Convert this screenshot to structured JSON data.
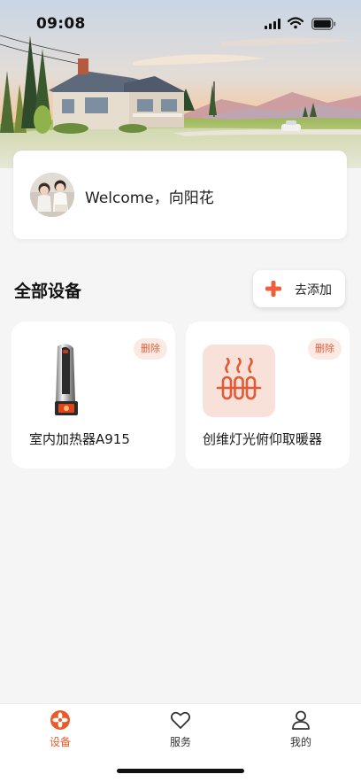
{
  "status_bar": {
    "time": "09:08",
    "icons": [
      "cellular-signal-icon",
      "wifi-icon",
      "battery-icon"
    ]
  },
  "welcome": {
    "text": "Welcome，向阳花",
    "avatar": "avatar"
  },
  "devices_section": {
    "title": "全部设备",
    "add_label": "去添加",
    "add_icon": "plus-icon"
  },
  "devices": [
    {
      "name": "室内加热器A915",
      "delete_label": "删除",
      "icon": "tower-heater-icon"
    },
    {
      "name": "创维灯光俯仰取暖器",
      "delete_label": "删除",
      "icon": "heater-waves-icon"
    }
  ],
  "tabbar": {
    "items": [
      {
        "label": "设备",
        "icon": "fan-icon",
        "active": true
      },
      {
        "label": "服务",
        "icon": "heart-icon",
        "active": false
      },
      {
        "label": "我的",
        "icon": "person-icon",
        "active": false
      }
    ]
  },
  "colors": {
    "accent": "#ea5b2a",
    "badge_bg": "#fbe9e3",
    "page_bg": "#f5f5f5"
  }
}
